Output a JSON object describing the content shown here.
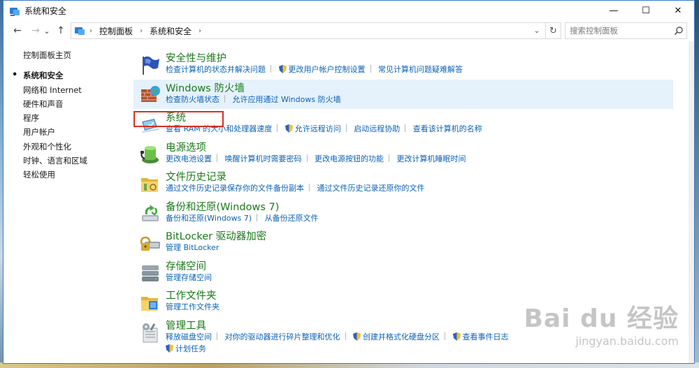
{
  "window": {
    "title": "系统和安全",
    "minimize": "—",
    "maximize": "☐",
    "close": "✕"
  },
  "address": {
    "back": "←",
    "forward": "→",
    "recent": "⌄",
    "up": "↑",
    "crumbs": [
      "控制面板",
      "系统和安全"
    ],
    "dropdown": "⌄",
    "refresh": "↻"
  },
  "search": {
    "placeholder": "搜索控制面板"
  },
  "leftnav": {
    "items": [
      "控制面板主页",
      "系统和安全",
      "网络和 Internet",
      "硬件和声音",
      "程序",
      "用户帐户",
      "外观和个性化",
      "时钟、语言和区域",
      "轻松使用"
    ]
  },
  "categories": [
    {
      "title": "安全性与维护",
      "links": [
        {
          "text": "检查计算机的状态并解决问题",
          "shield": false
        },
        {
          "text": "更改用户帐户控制设置",
          "shield": true
        },
        {
          "text": "常见计算机问题疑难解答",
          "shield": false
        }
      ]
    },
    {
      "title": "Windows 防火墙",
      "links": [
        {
          "text": "检查防火墙状态",
          "shield": false
        },
        {
          "text": "允许应用通过 Windows 防火墙",
          "shield": false
        }
      ]
    },
    {
      "title": "系统",
      "links": [
        {
          "text": "查看 RAM 的大小和处理器速度",
          "shield": false
        },
        {
          "text": "允许远程访问",
          "shield": true
        },
        {
          "text": "启动远程协助",
          "shield": false
        },
        {
          "text": "查看该计算机的名称",
          "shield": false
        }
      ]
    },
    {
      "title": "电源选项",
      "links": [
        {
          "text": "更改电池设置",
          "shield": false
        },
        {
          "text": "唤醒计算机时需要密码",
          "shield": false
        },
        {
          "text": "更改电源按钮的功能",
          "shield": false
        },
        {
          "text": "更改计算机睡眠时间",
          "shield": false
        }
      ]
    },
    {
      "title": "文件历史记录",
      "links": [
        {
          "text": "通过文件历史记录保存你的文件备份副本",
          "shield": false
        },
        {
          "text": "通过文件历史记录还原你的文件",
          "shield": false
        }
      ]
    },
    {
      "title": "备份和还原(Windows 7)",
      "links": [
        {
          "text": "备份和还原(Windows 7)",
          "shield": false
        },
        {
          "text": "从备份还原文件",
          "shield": false
        }
      ]
    },
    {
      "title": "BitLocker 驱动器加密",
      "links": [
        {
          "text": "管理 BitLocker",
          "shield": false
        }
      ]
    },
    {
      "title": "存储空间",
      "links": [
        {
          "text": "管理存储空间",
          "shield": false
        }
      ]
    },
    {
      "title": "工作文件夹",
      "links": [
        {
          "text": "管理工作文件夹",
          "shield": false
        }
      ]
    },
    {
      "title": "管理工具",
      "links": [
        {
          "text": "释放磁盘空间",
          "shield": false
        },
        {
          "text": "对你的驱动器进行碎片整理和优化",
          "shield": false
        },
        {
          "text": "创建并格式化硬盘分区",
          "shield": true
        },
        {
          "text": "查看事件日志",
          "shield": true
        }
      ],
      "links2": [
        {
          "text": "计划任务",
          "shield": true
        }
      ]
    }
  ],
  "watermark": {
    "logo": "Bai du 经验",
    "url": "jingyan.baidu.com"
  },
  "colors": {
    "category_title": "#1b7a1b",
    "link": "#0b62b8",
    "hover_row": "#e5f1fb",
    "highlight": "#d93025"
  }
}
